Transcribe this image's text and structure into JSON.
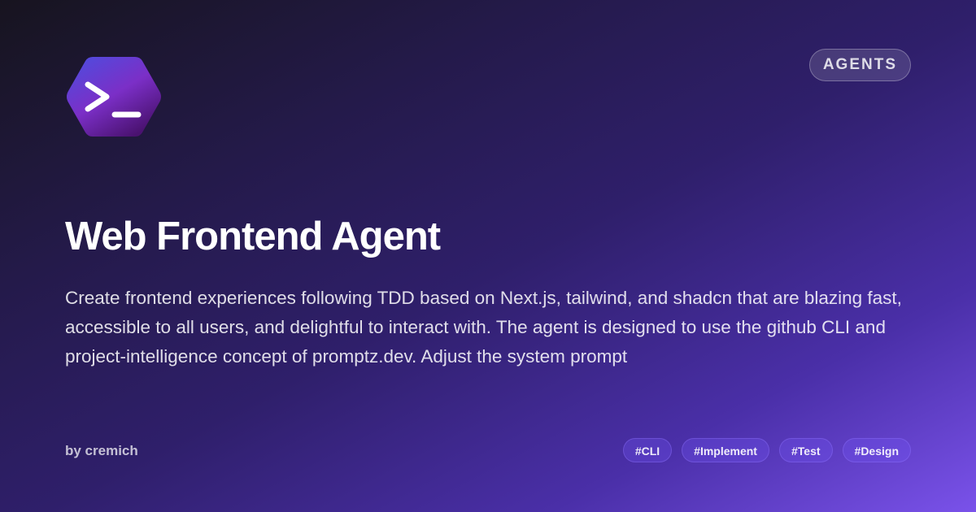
{
  "logo": {
    "icon": "terminal-prompt-icon",
    "colors": [
      "#4a4fe0",
      "#7b2fc7",
      "#4a1270"
    ]
  },
  "category": {
    "label": "AGENTS"
  },
  "title": "Web Frontend Agent",
  "description": "Create frontend experiences following TDD based on Next.js, tailwind, and shadcn that are blazing fast, accessible to all users, and delightful to interact with. The agent is designed to use the github CLI and project-intelligence concept of promptz.dev. Adjust the system prompt",
  "author": "by cremich",
  "tags": [
    "#CLI",
    "#Implement",
    "#Test",
    "#Design"
  ],
  "colors": {
    "background_start": "#17141f",
    "background_end": "#7a52ea",
    "tag_bg": "#4b3aa8"
  }
}
